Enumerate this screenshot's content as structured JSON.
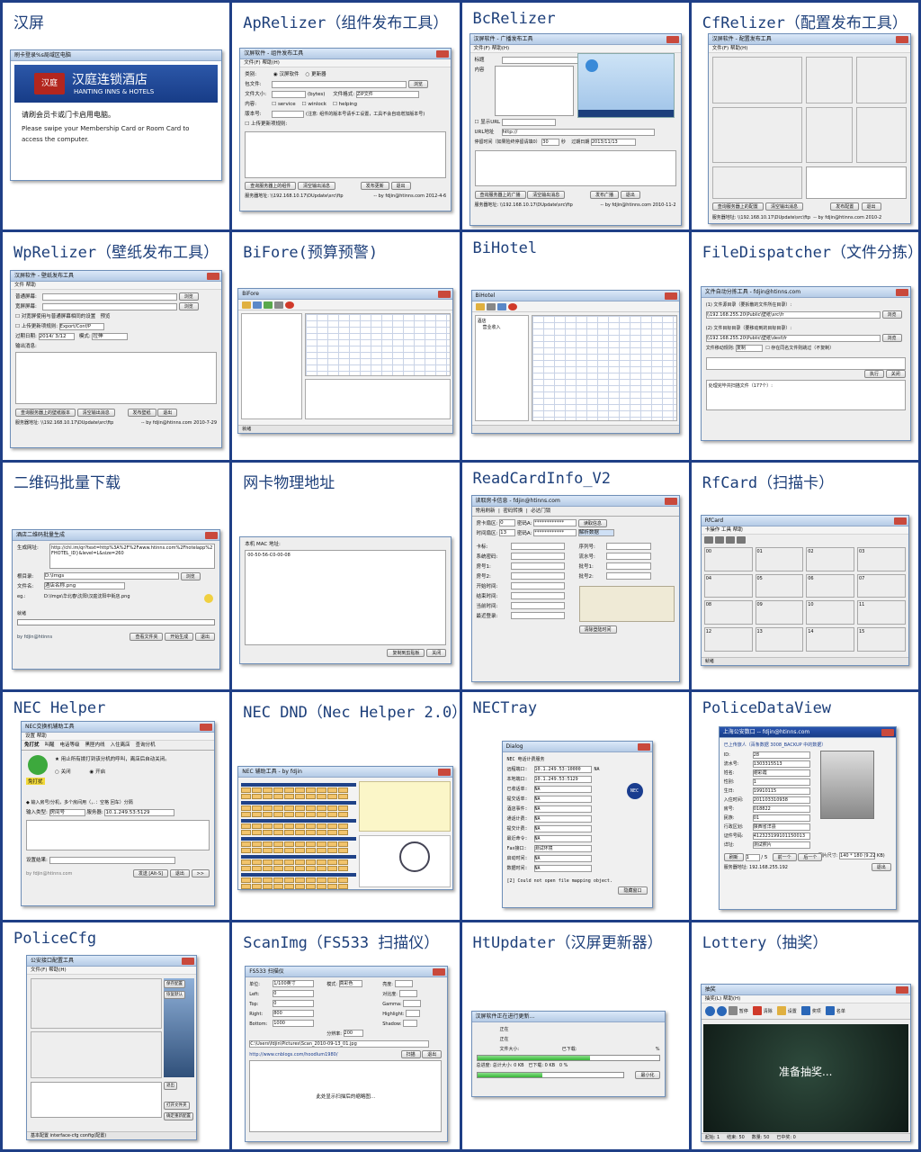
{
  "cells": {
    "hanping": {
      "title": "汉屏",
      "win_title": "刷卡登录%s局域区电脑",
      "brand_cn": "汉庭连锁酒店",
      "brand_en": "HANTING INNS & HOTELS",
      "logo_text": "汉庭",
      "prompt_cn": "请刷会员卡或门卡启用电脑。",
      "prompt_en": "Please swipe your Membership Card or Room Card to access the computer."
    },
    "aprelizer": {
      "title": "ApRelizer（组件发布工具）",
      "win_title": "汉屏软件 - 组件发布工具",
      "menu": "文件(F)    帮助(H)",
      "type_label": "类别:",
      "type_opt1": "汉屏软件",
      "type_opt2": "更新器",
      "pkg_label": "包文件:",
      "browse": "浏览",
      "size_label": "文件大小:",
      "bytes": "(bytes)",
      "format_label": "文件格式:",
      "format_value": "ZIP文件",
      "content_label": "内容:",
      "c1": "service",
      "c2": "winlock",
      "c3": "helping",
      "ver_label": "版本号:",
      "ver_note": "(注意: 组件的版本号请手工设置，工具不会自动增加版本号)",
      "upload_check": "上传更新项规则:",
      "btn_query": "查询服务器上的组件",
      "btn_clear": "清空输出消息",
      "btn_publish": "发布更新",
      "btn_exit": "退出",
      "server_label": "服务器地址:",
      "server_value": "\\\\192.168.10.17\\DUpdate\\src\\ftp",
      "by": "-- by fdjin@htinns.com 2012-4-6"
    },
    "bcrelizer": {
      "title": "BcRelizer",
      "win_title": "汉屏软件 - 广播发布工具",
      "menu": "文件(F)    帮助(H)",
      "lbl_title": "标题",
      "lbl_content": "内容",
      "lbl_url_check": "显示URL",
      "lbl_url": "URL地址",
      "url_value": "http://",
      "lbl_stay": "停留时间（如果险终停留请填0）",
      "stay_value": "30",
      "sec": "秒",
      "lbl_expire": "过期日期",
      "expire_value": "2013/11/13",
      "btn_query": "查询服务器上的广播",
      "btn_clear": "清空输出消息",
      "btn_publish": "发布广播",
      "btn_exit": "退出",
      "server_label": "服务器地址:",
      "server_value": "\\\\192.168.10.17\\DUpdate\\src\\ftp",
      "by": "-- by fdjin@htinns.com 2010-11-2"
    },
    "cfrelizer": {
      "title": "CfRelizer（配置发布工具）",
      "win_title": "汉屏软件 - 配置发布工具",
      "menu": "文件(F)    帮助(H)",
      "btn_query": "查询服务器上的配置",
      "btn_clear": "清空输出消息",
      "btn_publish": "发布配置",
      "btn_exit": "退出",
      "server_label": "服务器地址:",
      "server_value": "\\\\192.168.10.17\\DUpdate\\src\\ftp",
      "by": "-- by fdjin@htinns.com 2010-2"
    },
    "wprelizer": {
      "title": "WpRelizer（壁纸发布工具）",
      "win_title": "汉屏软件 - 壁纸发布工具",
      "menu": "文件    帮助",
      "normal_label": "普通屏幕:",
      "wide_label": "宽屏屏幕:",
      "browse": "浏览",
      "check1": "对宽屏使用与普通屏幕相同的设置",
      "check2": "上传更新项规则:",
      "rule_value": "Export/Conf/P",
      "preview": "预览",
      "expire_label": "过期日期:",
      "expire_value": "2014/ 3/12",
      "mode_label": "模式:",
      "mode_value": "拉伸",
      "output_label": "输出消息:",
      "btn_query": "查询服务器上的壁纸版本",
      "btn_clear": "清空输出消息",
      "btn_publish": "发布壁纸",
      "btn_exit": "退出",
      "server_label": "服务器地址:",
      "server_value": "\\\\192.168.10.17\\DUpdate\\src\\ftp",
      "by": "-- by fdjin@htinns.com 2010-7-29"
    },
    "bifore": {
      "title": "BiFore(预算预警)",
      "win_title": "BiFore",
      "status": "就绪"
    },
    "bihotel": {
      "title": "BiHotel",
      "win_title": "BiHotel",
      "tree1": "酒店",
      "tree2": "营业收入"
    },
    "filedispatcher": {
      "title": "FileDispatcher（文件分拣）",
      "win_title": "文件自动分拣工具 - fdjin@htinns.com",
      "step1": "(1) 文件源目录（要拆散的文件所在目录）:",
      "path1": "\\\\192.168.255.20\\Public\\壁纸\\src\\fr",
      "step2": "(2) 文件目标目录（要移动到的目标目录）:",
      "path2": "\\\\192.168.255.20\\Public\\壁纸\\dest\\fr",
      "browse": "浏览",
      "rule_label": "文件移动规则:",
      "rule_value": "复制",
      "overwrite": "存在同名文件则跳过（不复制）",
      "btn_run": "执行",
      "btn_close": "关闭",
      "log": "处理完毕共扫描文件（177个）:"
    },
    "qrcode": {
      "title": "二维码批量下载",
      "win_title": "酒店二维码批量生成",
      "url_label": "生成网址:",
      "url_value": "http://chl.im/qr?text=http%3A%2F%2Fwww.htinns.com%2Fhotelapp%2FHOTEL_ID}&level=L&size=260",
      "root_label": "根目录:",
      "root_value": "D:\\Imgs",
      "browse": "浏览",
      "name_label": "文件名:",
      "name_value": "酒店名称.png",
      "eg_label": "eg.:",
      "eg_value": "D:\\Imgs\\华北春\\沈阳\\汉庭沈阳中街店.png",
      "ready": "就绪",
      "by": "by fdjin@htinns",
      "btn_view": "查看文件夹",
      "btn_start": "开始生成",
      "btn_exit": "退出"
    },
    "mac": {
      "title": "网卡物理地址",
      "label": "本机 MAC 地址:",
      "value": "00-50-56-C0-00-08",
      "btn_copy": "复制到剪贴板",
      "btn_close": "关闭"
    },
    "readcard": {
      "title": "ReadCardInfo_V2",
      "win_title": "读取房卡信息 - fdjin@htinns.com",
      "tab1": "常用刷新",
      "tab2": "密码转换",
      "tab3": "必达门锁",
      "room_label": "房卡扇区:",
      "room_value": "0",
      "pwda": "密码A:",
      "pwda_value": "************",
      "read_btn": "读取信息",
      "time_label": "时间扇区:",
      "time_value": "13",
      "pwdb": "密码A:",
      "pwdb_value": "************",
      "parse": "解析数据",
      "f1": "卡标:",
      "f2": "系统密码:",
      "f3": "房号1:",
      "f4": "房号2:",
      "f5": "开始时间:",
      "f6": "结束时间:",
      "f7": "当前时间:",
      "f8": "最近登录:",
      "g1": "序列号:",
      "g2": "流水号:",
      "g3": "批号1:",
      "g4": "批号2:",
      "clear_btn": "清除登陆时间"
    },
    "rfcard": {
      "title": "RfCard（扫描卡）",
      "win_title": "RfCard",
      "menu": "卡操作    工具    帮助",
      "status": "就绪",
      "sectors": [
        "00",
        "01",
        "02",
        "03",
        "04",
        "05",
        "06",
        "07",
        "08",
        "09",
        "10",
        "11",
        "12",
        "13",
        "14",
        "15"
      ]
    },
    "nechelper": {
      "title": "NEC Helper",
      "win_title": "NEC交换机辅助工具",
      "menu": "设置    帮助",
      "tabs": [
        "免打扰",
        "叫醒",
        "电话等级",
        "黑匣内线",
        "入住离店",
        "查询分机"
      ],
      "dnd_desc": "用止所有拨打到该分机的呼叫，离店后自动关闭。",
      "off": "关闭",
      "on": "开启",
      "badge": "免打扰",
      "input_hint": "输入房号/分机，多个房间用（，．：空格 回车）分隔",
      "type_label": "输入类型:",
      "type_value": "房间号",
      "server_label": "服务器:",
      "server_value": "10.1.249.53:5129",
      "result_label": "设置结果:",
      "by": "by fdjin@htinns.com",
      "send": "发送 [Alt-S]",
      "exit": "退出",
      "more": ">>"
    },
    "necdnd": {
      "title": "NEC DND（Nec Helper 2.0）",
      "win_title": "NEC 辅助工具 - by fdjin"
    },
    "nectray": {
      "title": "NECTray",
      "win_title": "Dialog",
      "heading": "NEC 电话计费服务",
      "listen_label": "远程端口:",
      "listen_value": "10.1.249.53:10000",
      "listen_suffix": "NA",
      "local_label": "本地端口:",
      "local_value": "10.1.249.53:5129",
      "rows": [
        {
          "k": "已收话单:",
          "v": "NA"
        },
        {
          "k": "提交话单:",
          "v": "NA"
        },
        {
          "k": "酒店事件:",
          "v": "NA"
        },
        {
          "k": "通话计费:",
          "v": "NA"
        },
        {
          "k": "提交计费:",
          "v": "NA"
        },
        {
          "k": "最近命令:",
          "v": "NA"
        },
        {
          "k": "Fax接口:",
          "v": "测试环境"
        },
        {
          "k": "启动时间:",
          "v": "NA"
        },
        {
          "k": "数据时间:",
          "v": "NA"
        }
      ],
      "error": "[2] Could not open file mapping object.",
      "hide_btn": "隐藏窗口",
      "badge": "NEC"
    },
    "policedataview": {
      "title": "PoliceDataView",
      "win_title": "上海公安数口 -- fdjin@htinns.com",
      "subtitle": "已上传旅人（百条数据 3008_BACKUP 中的数据）",
      "rows": [
        {
          "k": "ID:",
          "v": "28"
        },
        {
          "k": "流水号:",
          "v": "1303315513"
        },
        {
          "k": "姓名:",
          "v": "谢彩霞"
        },
        {
          "k": "性别:",
          "v": "1"
        },
        {
          "k": "生日:",
          "v": "19910115"
        },
        {
          "k": "入住时间:",
          "v": "201103310938"
        },
        {
          "k": "房号:",
          "v": "018822"
        },
        {
          "k": "民族:",
          "v": "01"
        },
        {
          "k": "行政区划:",
          "v": "陕西省洋县"
        },
        {
          "k": "证件号码:",
          "v": "412323199101150013"
        },
        {
          "k": "详址:",
          "v": "测试照片"
        }
      ],
      "photo_label": "图片尺寸:",
      "photo_value": "140 * 180 (9.22 KB)",
      "page_value": "1",
      "page_total": "5",
      "prev": "前一个",
      "next": "后一个",
      "refresh": "刷新",
      "server_label": "服务器地址:",
      "server_value": "192.168.255.192",
      "exit": "退出"
    },
    "policecfg": {
      "title": "PoliceCfg",
      "win_title": "公安接口配置工具",
      "menu": "文件(F)    帮助(H)",
      "save_btn": "保存配置",
      "restore_btn": "恢复默认",
      "exit_btn": "退出",
      "open_btn": "打开文件夹",
      "apply_btn": "确定重新配置",
      "status": "基本配置    interface-cfg    config(配置)"
    },
    "scanimg": {
      "title": "ScanImg（FS533 扫描仪）",
      "win_title": "FS533 扫描仪",
      "left_labels": [
        "单位:",
        "Left:",
        "Top:",
        "Right:",
        "Bottom:",
        "Filename:"
      ],
      "left_values": [
        "1/100英寸",
        "0",
        "0",
        "800",
        "1000",
        ""
      ],
      "mode_label": "模式:",
      "mode_value": "真彩色",
      "dpi_label": "分辨率:",
      "dpi_value": "200",
      "bright_label": "亮度:",
      "contrast_label": "对比度:",
      "gamma_label": "Gamma:",
      "highlight_label": "Highlight:",
      "shadow_label": "Shadow:",
      "filename_value": "C:\\Users\\fdjin\\Pictures\\Scan_2010-09-13_01.jpg",
      "url": "http://www.cnblogs.com/hoodlum1980/",
      "btn_scan": "扫描",
      "btn_exit": "退出",
      "preview_text": "此处显示扫描后的缩略图..."
    },
    "htupdater": {
      "title": "HtUpdater（汉屏更新器）",
      "win_title": "汉屏软件正在进行更新...",
      "r1": "正在",
      "r2": "正在",
      "file_size": "文件大小:",
      "downloaded": "已下载:",
      "total": "总进度:",
      "total_size": "总计大小:",
      "total_size_value": "0 KB",
      "downloaded_value": "0 KB",
      "pct_value": "0",
      "pct": "%",
      "minimize": "最小化",
      "progress1": 0.62,
      "progress2": 0.45
    },
    "lottery": {
      "title": "Lottery（抽奖）",
      "win_title": "抽奖",
      "menu": "抽奖(L)    帮助(H)",
      "center_text": "准备抽奖...",
      "tools": [
        "暂停",
        "清除",
        "设置",
        "奖项",
        "名单"
      ],
      "status_start": "起始: 1",
      "status_end": "结束: 50",
      "status_count": "数量: 50",
      "status_done": "已中奖: 0"
    }
  },
  "colors": {
    "page_bg": "#1f3f86",
    "title_color": "#1d3f7a",
    "hanting_red": "#b3261e",
    "hanting_blue": "#1a3d8f"
  }
}
